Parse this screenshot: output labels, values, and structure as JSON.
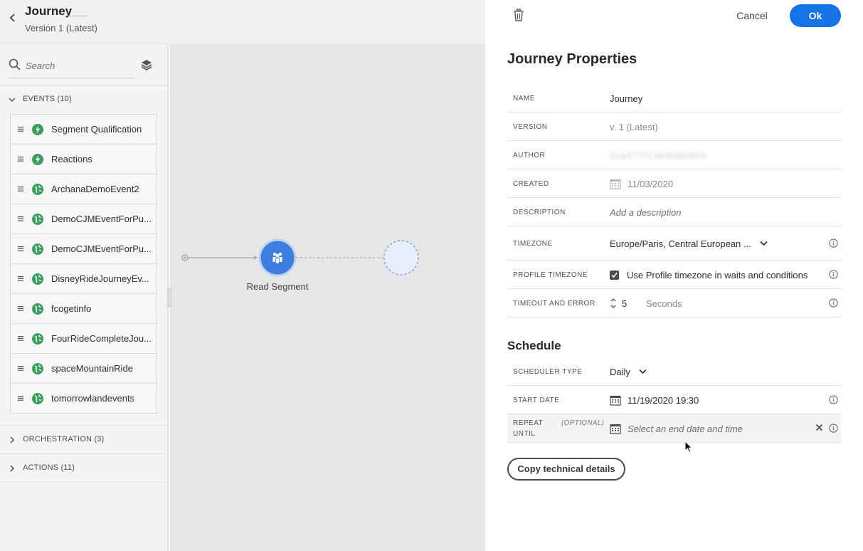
{
  "header": {
    "title": "Journey",
    "version": "Version 1 (Latest)"
  },
  "sidebar": {
    "search_placeholder": "Search",
    "sections": {
      "events": "EVENTS (10)",
      "orchestration": "ORCHESTRATION (3)",
      "actions": "ACTIONS (11)"
    },
    "events": [
      {
        "label": "Segment Qualification",
        "icon": "lightning-icon"
      },
      {
        "label": "Reactions",
        "icon": "lightning-icon"
      },
      {
        "label": "ArchanaDemoEvent2",
        "icon": "globe-icon"
      },
      {
        "label": "DemoCJMEventForPu...",
        "icon": "globe-icon"
      },
      {
        "label": "DemoCJMEventForPu...",
        "icon": "globe-icon"
      },
      {
        "label": "DisneyRideJourneyEv...",
        "icon": "globe-icon"
      },
      {
        "label": "fcogetinfo",
        "icon": "globe-icon"
      },
      {
        "label": "FourRideCompleteJou...",
        "icon": "globe-icon"
      },
      {
        "label": "spaceMountainRide",
        "icon": "globe-icon"
      },
      {
        "label": "tomorrowlandevents",
        "icon": "globe-icon"
      }
    ]
  },
  "canvas": {
    "node_label": "Read Segment"
  },
  "panel": {
    "cancel_label": "Cancel",
    "ok_label": "Ok",
    "title": "Journey Properties",
    "properties": {
      "name_label": "NAME",
      "name_value": "Journey",
      "version_label": "VERSION",
      "version_value": "v. 1 (Latest)",
      "author_label": "AUTHOR",
      "author_value": "2ca577f138d0d0804",
      "created_label": "CREATED",
      "created_value": "11/03/2020",
      "description_label": "DESCRIPTION",
      "description_placeholder": "Add a description",
      "timezone_label": "TIMEZONE",
      "timezone_value": "Europe/Paris, Central European ...",
      "profile_timezone_label": "PROFILE TIMEZONE",
      "profile_timezone_value": "Use Profile timezone in waits and conditions",
      "profile_timezone_checked": true,
      "timeout_label": "TIMEOUT AND ERROR",
      "timeout_value": "5",
      "timeout_unit": "Seconds"
    },
    "schedule": {
      "title": "Schedule",
      "scheduler_type_label": "SCHEDULER TYPE",
      "scheduler_type_value": "Daily",
      "start_date_label": "START DATE",
      "start_date_value": "11/19/2020 19:30",
      "repeat_until_label": "REPEAT UNTIL",
      "repeat_until_optional": "(OPTIONAL)",
      "repeat_until_placeholder": "Select an end date and time"
    },
    "copy_button_label": "Copy technical details"
  },
  "colors": {
    "accent": "#1473e6",
    "event_icon_green": "#3a9e5f",
    "node_blue": "#3d7de0"
  }
}
